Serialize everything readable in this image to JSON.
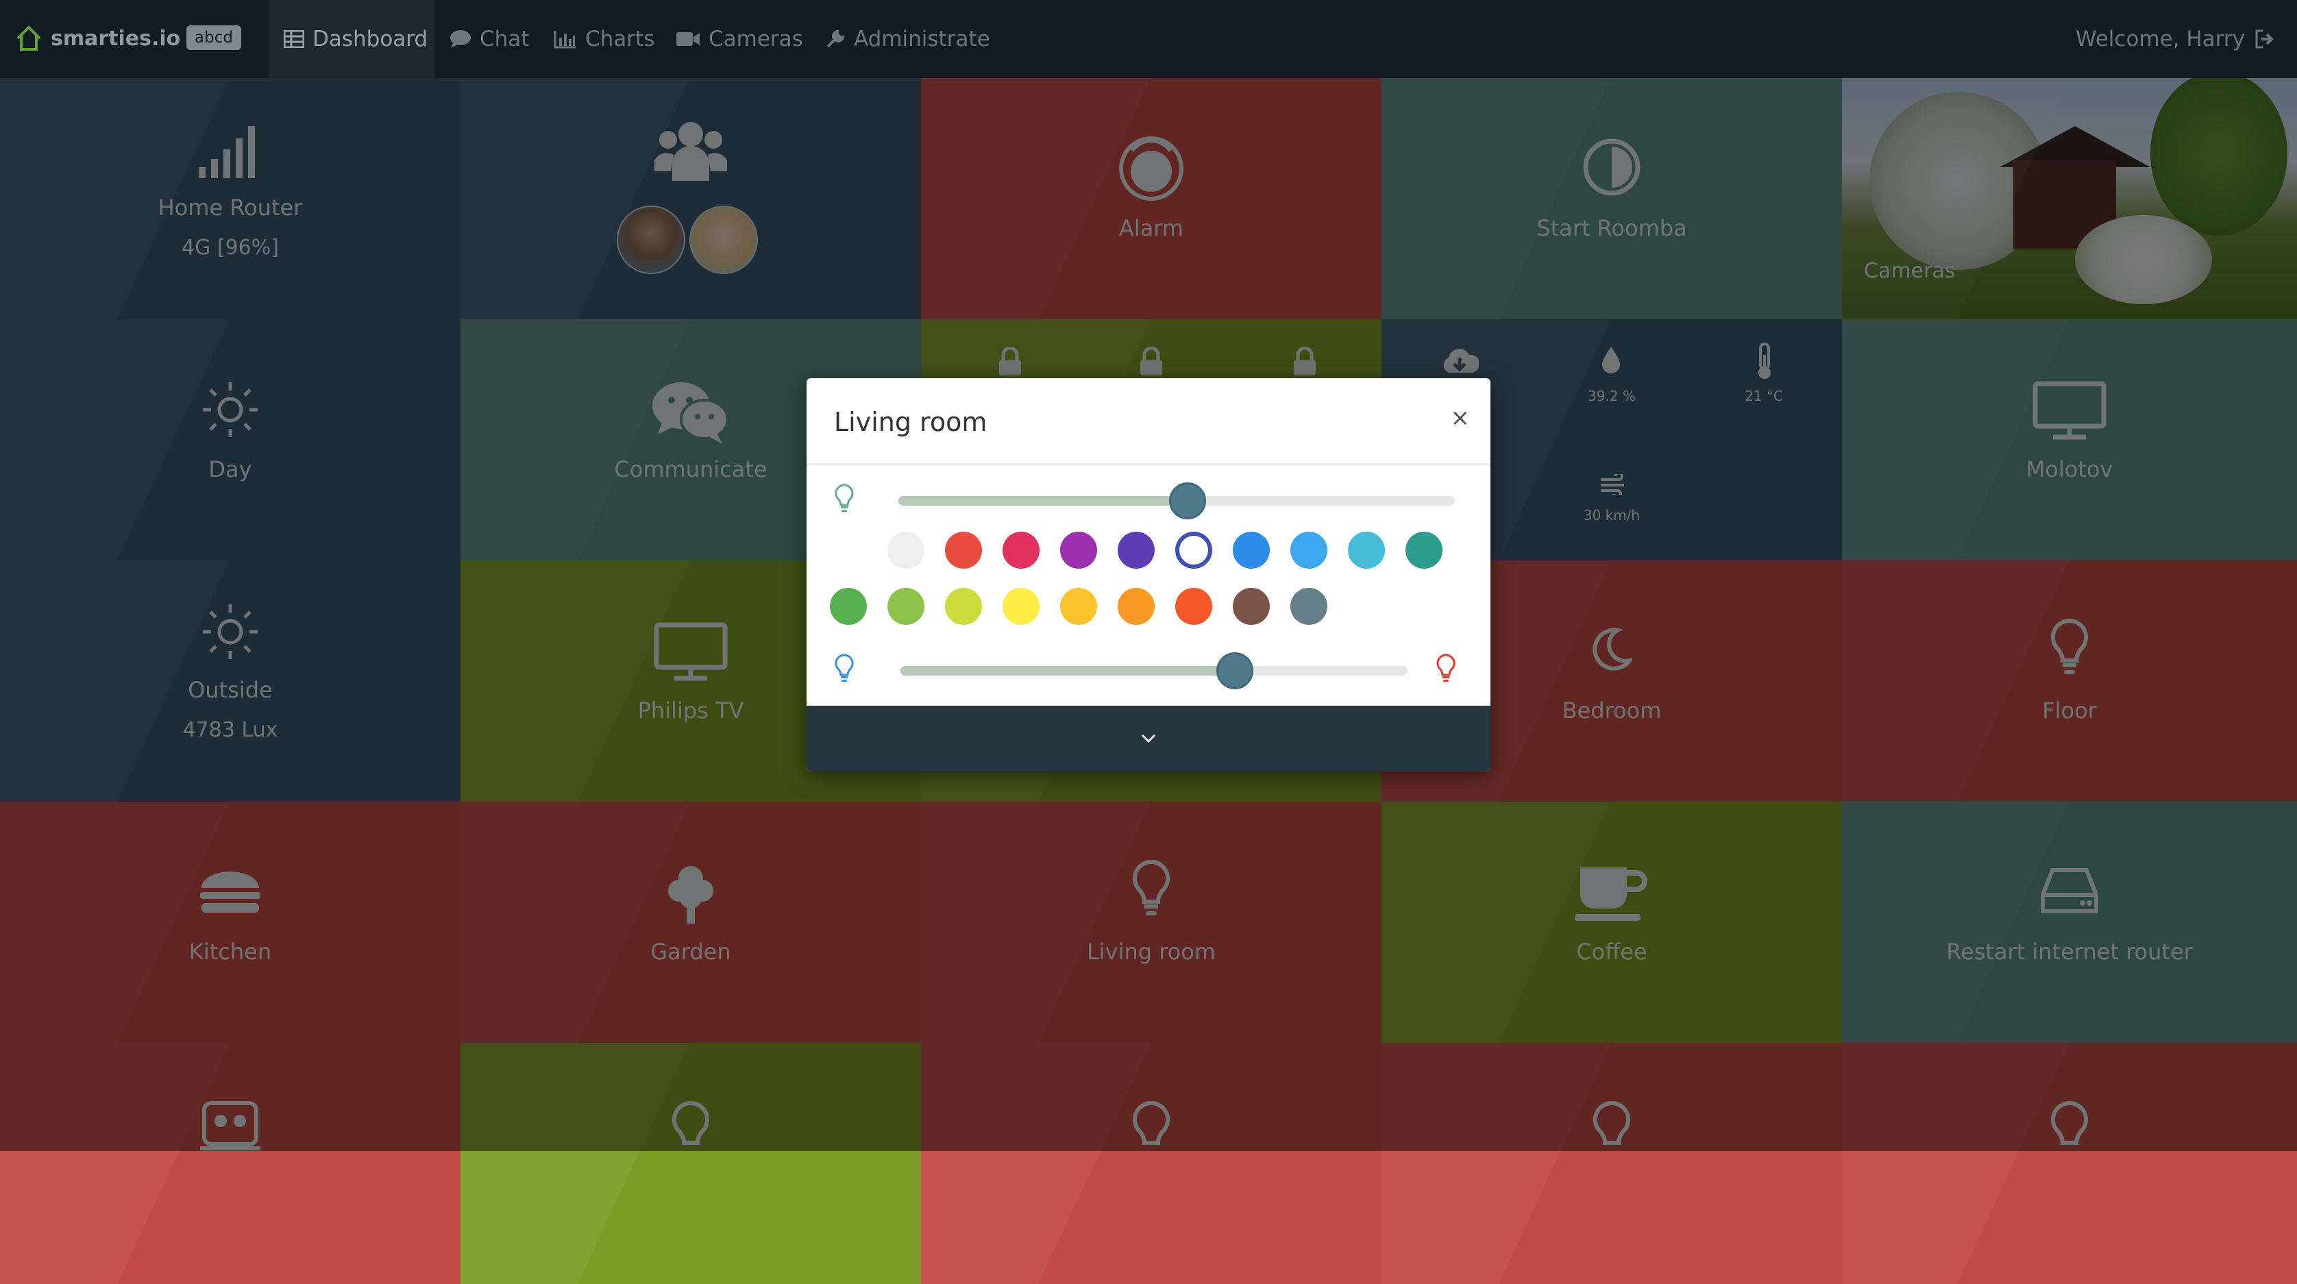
{
  "nav": {
    "brand": "smarties.io",
    "badge": "abcd",
    "items": [
      {
        "label": "Dashboard",
        "icon": "table-icon",
        "active": true
      },
      {
        "label": "Chat",
        "icon": "comment-icon"
      },
      {
        "label": "Charts",
        "icon": "bar-chart-icon"
      },
      {
        "label": "Cameras",
        "icon": "video-camera-icon"
      },
      {
        "label": "Administrate",
        "icon": "wrench-icon"
      }
    ],
    "welcome": "Welcome, Harry"
  },
  "tiles": {
    "home_router": {
      "label": "Home Router",
      "value": "4G [96%]",
      "icon": "signal-icon"
    },
    "users": {
      "icon": "users-icon"
    },
    "alarm": {
      "label": "Alarm",
      "icon": "alarm-icon"
    },
    "roomba": {
      "label": "Start Roomba",
      "icon": "half-circle-icon"
    },
    "cameras": {
      "label": "Cameras"
    },
    "day": {
      "label": "Day",
      "icon": "sun-icon"
    },
    "communicate": {
      "label": "Communicate",
      "icon": "wechat-icon"
    },
    "weather": {
      "humidity": "39.2 %",
      "temperature": "21 °C",
      "wind": "30 km/h"
    },
    "molotov": {
      "label": "Molotov",
      "icon": "monitor-icon"
    },
    "outside": {
      "label": "Outside",
      "value": "4783 Lux",
      "icon": "sun-icon"
    },
    "philips_tv": {
      "label": "Philips TV",
      "icon": "monitor-icon"
    },
    "bedroom": {
      "label": "Bedroom",
      "icon": "moon-icon"
    },
    "floor": {
      "label": "Floor",
      "icon": "lightbulb-icon"
    },
    "kitchen": {
      "label": "Kitchen",
      "icon": "burger-icon"
    },
    "garden": {
      "label": "Garden",
      "icon": "tree-icon"
    },
    "living_room": {
      "label": "Living room",
      "icon": "lightbulb-icon"
    },
    "coffee": {
      "label": "Coffee",
      "icon": "coffee-icon"
    },
    "restart_router": {
      "label": "Restart internet router",
      "icon": "hdd-icon"
    }
  },
  "modal": {
    "title": "Living room",
    "close": "×",
    "brightness": 0.52,
    "temperature": 0.66,
    "colors_row1": [
      "#eeeeee",
      "#e74c3c",
      "#e2305f",
      "#9c30b0",
      "#5e3cb4",
      "#ffffff",
      "#2f8be8",
      "#3ba8f0",
      "#44bcd8",
      "#2e9c8c"
    ],
    "colors_row2": [
      "#58b04f",
      "#8cc34b",
      "#cbdc3c",
      "#ffec44",
      "#fbc22c",
      "#f99a24",
      "#f5572a",
      "#7a5446",
      "#657f8a"
    ],
    "selected_color": "#3f51b5",
    "colors": {
      "bulb_green": "#6aa79a",
      "bulb_blue": "#3a8ee8",
      "bulb_red": "#e53935"
    }
  }
}
